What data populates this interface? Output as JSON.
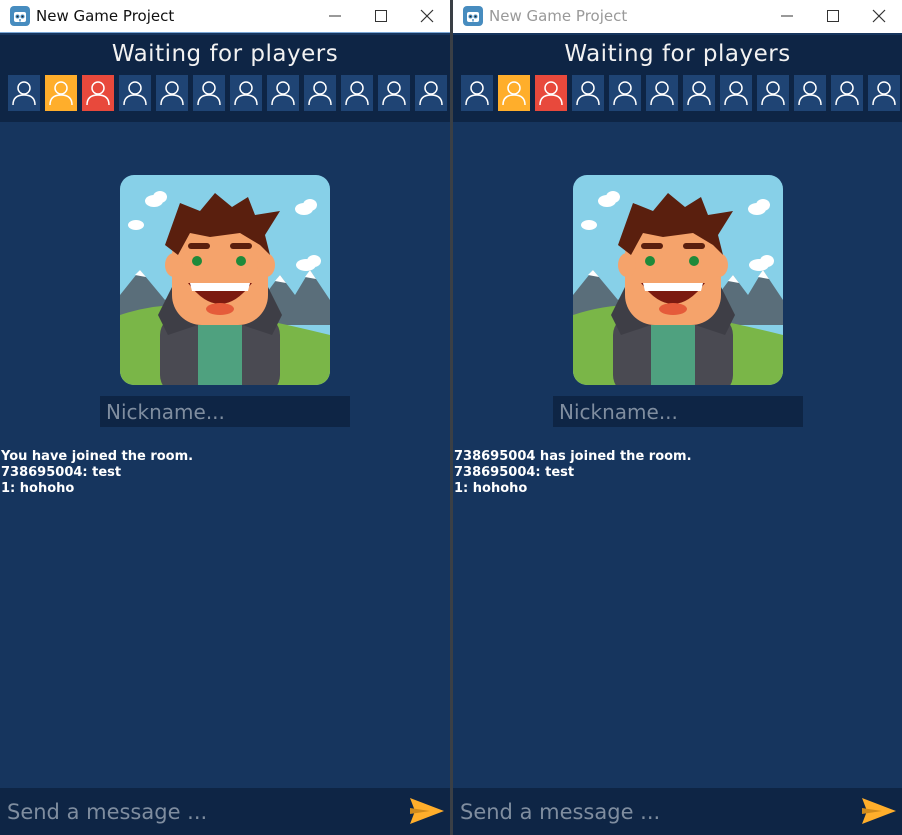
{
  "windows": [
    {
      "title": "New Game Project",
      "header_title": "Waiting for players",
      "slots": [
        "empty",
        "orange",
        "red",
        "empty",
        "empty",
        "empty",
        "empty",
        "empty",
        "empty",
        "empty",
        "empty",
        "empty"
      ],
      "nickname_placeholder": "Nickname...",
      "chat": [
        "You have joined the room.",
        "738695004: test",
        "1: hohoho"
      ],
      "message_placeholder": "Send a message ...",
      "active": true
    },
    {
      "title": "New Game Project",
      "header_title": "Waiting for players",
      "slots": [
        "empty",
        "orange",
        "red",
        "empty",
        "empty",
        "empty",
        "empty",
        "empty",
        "empty",
        "empty",
        "empty",
        "empty"
      ],
      "nickname_placeholder": "Nickname...",
      "chat": [
        "738695004 has joined the room.",
        "738695004: test",
        "1: hohoho"
      ],
      "message_placeholder": "Send a message ...",
      "active": false
    }
  ],
  "icons": {
    "app": "godot-icon",
    "minimize": "minimize-icon",
    "maximize": "maximize-icon",
    "close": "close-icon",
    "slot": "person-icon",
    "send": "send-arrow-icon"
  },
  "colors": {
    "background": "#16355e",
    "panel": "#0e2545",
    "slot_empty": "#1f4474",
    "slot_orange": "#ffae2b",
    "slot_red": "#e8493c",
    "send_arrow": "#ffae2b"
  }
}
